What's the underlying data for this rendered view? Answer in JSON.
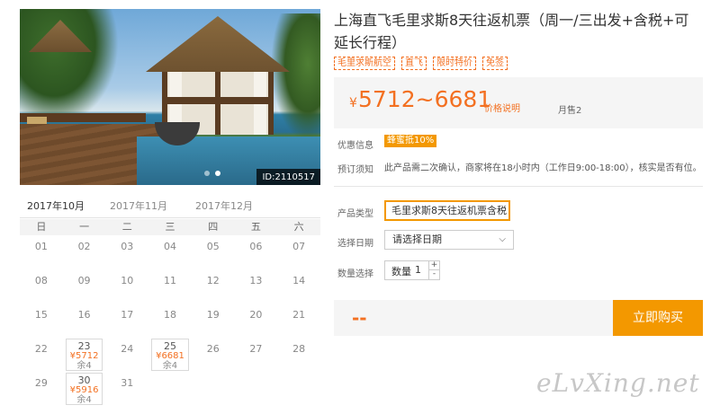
{
  "product": {
    "title": "上海直飞毛里求斯8天往返机票（周一/三出发+含税+可延长行程）",
    "tags": [
      "毛里求斯航空",
      "直飞",
      "限时特价",
      "免签"
    ],
    "image_id": "ID:2110517",
    "carousel": {
      "count": 3,
      "active": 2
    }
  },
  "price": {
    "currency": "¥",
    "range": "5712~6681",
    "note": "价格说明",
    "monthly_sold": "月售2"
  },
  "promo": {
    "label": "优惠信息",
    "badge": "蜂蜜抵10%"
  },
  "notice": {
    "label": "预订须知",
    "text": "此产品需二次确认，商家将在18小时内（工作日9:00-18:00），核实是否有位。"
  },
  "options": {
    "type_label": "产品类型",
    "type_value": "毛里求斯8天往返机票含税",
    "date_label": "选择日期",
    "date_placeholder": "请选择日期",
    "qty_label": "数量选择",
    "qty_prefix": "数量",
    "qty_value": "1",
    "qty_plus": "+",
    "qty_minus": "-"
  },
  "purchase": {
    "total": "--",
    "buy_label": "立即购买"
  },
  "calendar": {
    "months": [
      "2017年10月",
      "2017年11月",
      "2017年12月"
    ],
    "active_month": 0,
    "weekdays": [
      "日",
      "一",
      "二",
      "三",
      "四",
      "五",
      "六"
    ],
    "leading_blanks": 0,
    "days": [
      {
        "d": "01"
      },
      {
        "d": "02"
      },
      {
        "d": "03"
      },
      {
        "d": "04"
      },
      {
        "d": "05"
      },
      {
        "d": "06"
      },
      {
        "d": "07"
      },
      {
        "d": "08"
      },
      {
        "d": "09"
      },
      {
        "d": "10"
      },
      {
        "d": "11"
      },
      {
        "d": "12"
      },
      {
        "d": "13"
      },
      {
        "d": "14"
      },
      {
        "d": "15"
      },
      {
        "d": "16"
      },
      {
        "d": "17"
      },
      {
        "d": "18"
      },
      {
        "d": "19"
      },
      {
        "d": "20"
      },
      {
        "d": "21"
      },
      {
        "d": "22"
      },
      {
        "d": "23",
        "price": "¥5712",
        "stock": "余4"
      },
      {
        "d": "24"
      },
      {
        "d": "25",
        "price": "¥6681",
        "stock": "余4"
      },
      {
        "d": "26"
      },
      {
        "d": "27"
      },
      {
        "d": "28"
      },
      {
        "d": "29"
      },
      {
        "d": "30",
        "price": "¥5916",
        "stock": "余4"
      },
      {
        "d": "31"
      }
    ]
  },
  "watermark": "eLvXing.net"
}
